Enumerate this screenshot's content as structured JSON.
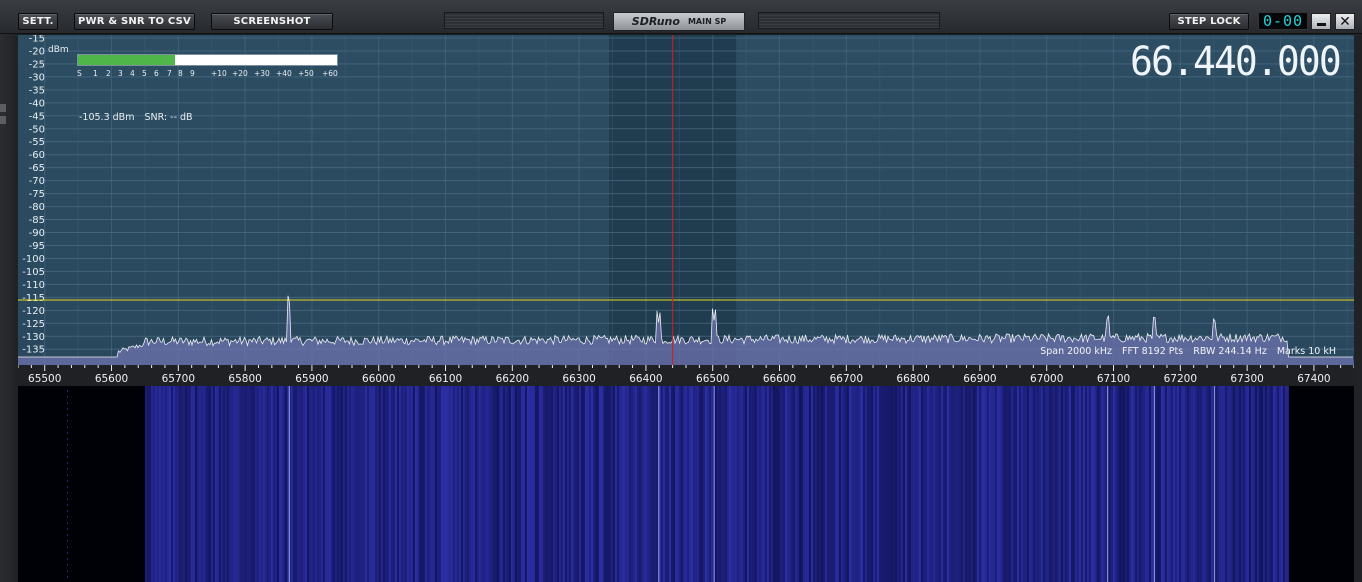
{
  "toolbar": {
    "settings_label": "SETT.",
    "export_label": "PWR & SNR TO CSV",
    "screenshot_label": "SCREENSHOT",
    "brand": "SDRuno",
    "mode": "MAIN SP",
    "step_lock_label": "STEP LOCK",
    "digit_display": "0-00"
  },
  "meter": {
    "unit_label": "dBm",
    "level_fraction": 0.375,
    "scale_labels": [
      "S",
      "1",
      "2",
      "3",
      "4",
      "5",
      "6",
      "7",
      "8",
      "9",
      "+10",
      "+20",
      "+30",
      "+40",
      "+50",
      "+60"
    ],
    "power_reading": "-105.3 dBm",
    "snr_reading": "SNR: -- dB"
  },
  "frequency_display": "66.440.000",
  "status": {
    "span": "Span 2000 kHz",
    "fft": "FFT 8192 Pts",
    "rbw": "RBW 244.14 Hz",
    "marks": "Marks 10 kH"
  },
  "colors": {
    "spectrum_bg": "#2d4d63",
    "trace_fill": "#6e73ad",
    "trace_line": "#ffffff",
    "center_marker": "#d61a1a",
    "squelch_line": "#e6d620",
    "meter_fill": "#4fb649",
    "filter_band": "#1f3a4c",
    "waterfall_signal": "#3b3ecf"
  },
  "chart_data": {
    "type": "area",
    "x_unit": "kHz",
    "y_unit": "dBm",
    "xlim": [
      65460,
      67460
    ],
    "ylim": [
      -138,
      -15
    ],
    "y_ticks": [
      -15,
      -20,
      -25,
      -30,
      -35,
      -40,
      -45,
      -50,
      -55,
      -60,
      -65,
      -70,
      -75,
      -80,
      -85,
      -90,
      -95,
      -100,
      -105,
      -110,
      -115,
      -120,
      -125,
      -130,
      -135
    ],
    "x_ticks": [
      65500,
      65600,
      65700,
      65800,
      65900,
      66000,
      66100,
      66200,
      66300,
      66400,
      66500,
      66600,
      66700,
      66800,
      66900,
      67000,
      67100,
      67200,
      67300,
      67400
    ],
    "center_frequency": 66440,
    "filter_band": [
      66345,
      66535
    ],
    "squelch_level": -116,
    "noise_floor": -132,
    "signal_range": [
      65650,
      67300
    ],
    "peaks": [
      {
        "x": 65866,
        "y": -118
      },
      {
        "x": 66419,
        "y": -125
      },
      {
        "x": 66502,
        "y": -124
      },
      {
        "x": 67091,
        "y": -125
      },
      {
        "x": 67161,
        "y": -125
      },
      {
        "x": 67251,
        "y": -126
      }
    ],
    "grid": true
  }
}
